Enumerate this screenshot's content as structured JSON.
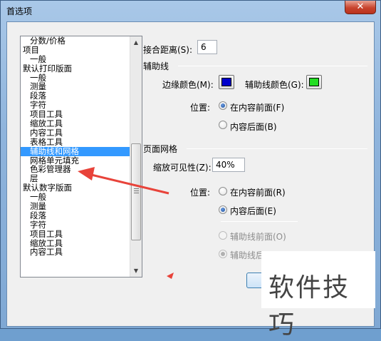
{
  "window": {
    "title": "首选项",
    "close_symbol": "✕"
  },
  "category_list": {
    "items": [
      {
        "label": "分数/价格",
        "indent": true,
        "selected": false
      },
      {
        "label": "项目",
        "indent": false,
        "selected": false
      },
      {
        "label": "一般",
        "indent": true,
        "selected": false
      },
      {
        "label": "默认打印版面",
        "indent": false,
        "selected": false
      },
      {
        "label": "一般",
        "indent": true,
        "selected": false
      },
      {
        "label": "测量",
        "indent": true,
        "selected": false
      },
      {
        "label": "段落",
        "indent": true,
        "selected": false
      },
      {
        "label": "字符",
        "indent": true,
        "selected": false
      },
      {
        "label": "项目工具",
        "indent": true,
        "selected": false
      },
      {
        "label": "缩放工具",
        "indent": true,
        "selected": false
      },
      {
        "label": "内容工具",
        "indent": true,
        "selected": false
      },
      {
        "label": "表格工具",
        "indent": true,
        "selected": false
      },
      {
        "label": "辅助线和网格",
        "indent": true,
        "selected": true
      },
      {
        "label": "网格单元填充",
        "indent": true,
        "selected": false
      },
      {
        "label": "色彩管理器",
        "indent": true,
        "selected": false
      },
      {
        "label": "层",
        "indent": true,
        "selected": false
      },
      {
        "label": "默认数字版面",
        "indent": false,
        "selected": false
      },
      {
        "label": "一般",
        "indent": true,
        "selected": false
      },
      {
        "label": "测量",
        "indent": true,
        "selected": false
      },
      {
        "label": "段落",
        "indent": true,
        "selected": false
      },
      {
        "label": "字符",
        "indent": true,
        "selected": false
      },
      {
        "label": "项目工具",
        "indent": true,
        "selected": false
      },
      {
        "label": "缩放工具",
        "indent": true,
        "selected": false
      },
      {
        "label": "内容工具",
        "indent": true,
        "selected": false
      }
    ],
    "scroll_up_symbol": "▲",
    "scroll_down_symbol": "▼"
  },
  "snap": {
    "label": "接合距离(S):",
    "value": "6"
  },
  "guides": {
    "section_title": "辅助线",
    "margin_color_label": "边缘颜色(M):",
    "margin_color": "#0000cc",
    "guide_color_label": "辅助线颜色(G):",
    "guide_color": "#22dd22",
    "position_label": "位置:",
    "option_front": "在内容前面(F)",
    "option_back": "内容后面(B)",
    "selected": "front"
  },
  "page_grid": {
    "section_title": "页面网格",
    "visibility_label": "缩放可见性(Z):",
    "visibility_value": "40%",
    "position_label": "位置:",
    "option_front": "在内容前面(R)",
    "option_back": "内容后面(E)",
    "selected": "back",
    "guide_front": "辅助线前面(O)",
    "guide_back": "辅助线后面(H)",
    "guide_selected": "back"
  },
  "watermark": {
    "text": "软件技巧"
  },
  "annotation": {
    "arrow_color": "#e8433a"
  }
}
